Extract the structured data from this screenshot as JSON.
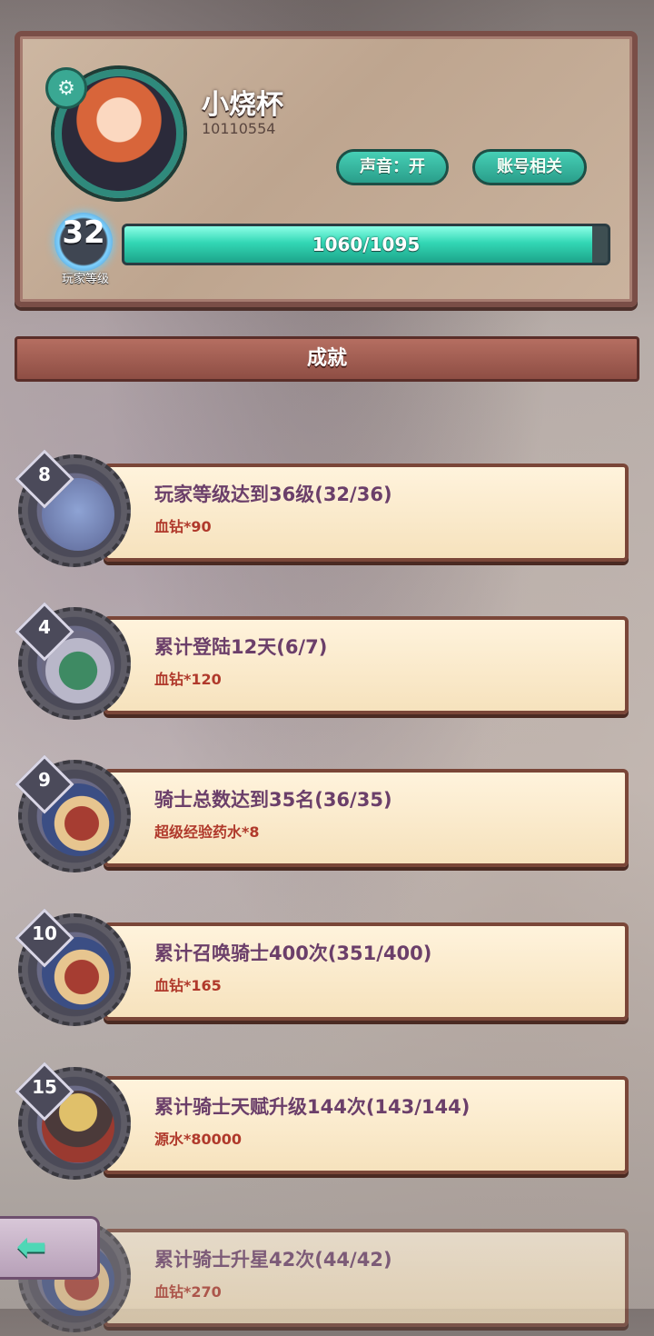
{
  "profile": {
    "username": "小烧杯",
    "user_id": "10110554",
    "sound_button": "声音：开",
    "account_button": "账号相关",
    "level": "32",
    "level_label": "玩家等级",
    "xp_text": "1060/1095",
    "xp_progress": 0.968
  },
  "section": {
    "title": "成就"
  },
  "achievements": [
    {
      "count": "8",
      "title": "玩家等级达到36级(32/36)",
      "reward": "血钻*90"
    },
    {
      "count": "4",
      "title": "累计登陆12天(6/7)",
      "reward": "血钻*120"
    },
    {
      "count": "9",
      "title": "骑士总数达到35名(36/35)",
      "reward": "超级经验药水*8"
    },
    {
      "count": "10",
      "title": "累计召唤骑士400次(351/400)",
      "reward": "血钻*165"
    },
    {
      "count": "15",
      "title": "累计骑士天赋升级144次(143/144)",
      "reward": "源水*80000"
    },
    {
      "count": "",
      "title": "累计骑士升星42次(44/42)",
      "reward": "血钻*270"
    }
  ],
  "icons": {
    "settings": "gear-icon",
    "back": "arrow-left-icon"
  },
  "colors": {
    "accent": "#33d7b5",
    "header": "#8e4e44",
    "title_text": "#6b3f6a",
    "reward_text": "#b0392b"
  }
}
